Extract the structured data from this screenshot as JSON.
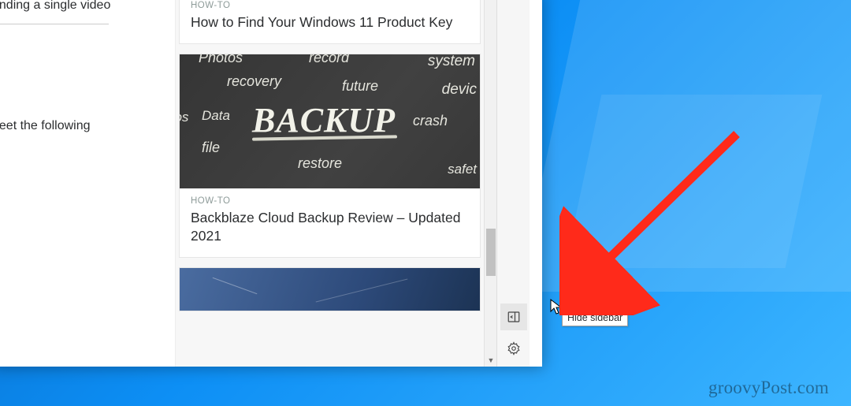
{
  "page_fragments": {
    "line1": "ending a single video",
    "line2": "neet the following"
  },
  "feed": [
    {
      "category": "HOW-TO",
      "title": "How to Find Your Windows 11 Product Key",
      "thumb": null
    },
    {
      "category": "HOW-TO",
      "title": "Backblaze Cloud Backup Review – Updated 2021",
      "thumb": {
        "main_word": "BACKUP",
        "words": [
          "Photos",
          "record",
          "system",
          "recovery",
          "future",
          "devic",
          "eos",
          "Data",
          "crash",
          "file",
          "restore",
          "safet"
        ]
      }
    }
  ],
  "rail": {
    "hide_btn_name": "hide-sidebar-button",
    "settings_btn_name": "settings-button"
  },
  "tooltip": "Hide sidebar",
  "watermark": "groovyPost.com"
}
